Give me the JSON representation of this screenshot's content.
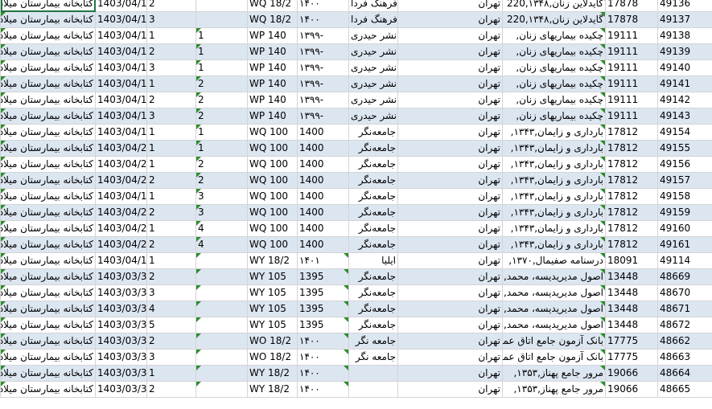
{
  "columns": [
    "library",
    "date",
    "copy",
    "volume",
    "call_number",
    "year",
    "publisher",
    "city",
    "title",
    "code",
    "record_id"
  ],
  "rows": [
    {
      "library": "کتابخانه بیمارستان میلاد",
      "date": "1403/04/1",
      "copy": "2",
      "volume": "",
      "call_number": "WQ 18/2",
      "year": "۱۴۰۰",
      "publisher": "فرهنگ فردا",
      "city": "تهران",
      "title": "گایدلاین زنان,220,۱۳۴۸",
      "code": "17878",
      "record_id": "49136"
    },
    {
      "library": "کتابخانه بیمارستان میلاد",
      "date": "1403/04/1",
      "copy": "3",
      "volume": "",
      "call_number": "WQ 18/2",
      "year": "۱۴۰۰",
      "publisher": "فرهنگ فردا",
      "city": "تهران",
      "title": "گایدلاین زنان,220,۱۳۴۸",
      "code": "17878",
      "record_id": "49137"
    },
    {
      "library": "کتابخانه بیمارستان میلاد",
      "date": "1403/04/1",
      "copy": "1",
      "volume": "1",
      "call_number": "WP 140",
      "year": "۱۳۹۹-",
      "publisher": "نشر حیدری",
      "city": "تهران",
      "title": "چکیده بیماریهای زنان,",
      "code": "19111",
      "record_id": "49138"
    },
    {
      "library": "کتابخانه بیمارستان میلاد",
      "date": "1403/04/1",
      "copy": "2",
      "volume": "1",
      "call_number": "WP 140",
      "year": "۱۳۹۹-",
      "publisher": "نشر حیدری",
      "city": "تهران",
      "title": "چکیده بیماریهای زنان,",
      "code": "19111",
      "record_id": "49139"
    },
    {
      "library": "کتابخانه بیمارستان میلاد",
      "date": "1403/04/1",
      "copy": "3",
      "volume": "1",
      "call_number": "WP 140",
      "year": "۱۳۹۹-",
      "publisher": "نشر حیدری",
      "city": "تهران",
      "title": "چکیده بیماریهای زنان,",
      "code": "19111",
      "record_id": "49140"
    },
    {
      "library": "کتابخانه بیمارستان میلاد",
      "date": "1403/04/1",
      "copy": "1",
      "volume": "2",
      "call_number": "WP 140",
      "year": "۱۳۹۹-",
      "publisher": "نشر حیدری",
      "city": "تهران",
      "title": "چکیده بیماریهای زنان,",
      "code": "19111",
      "record_id": "49141"
    },
    {
      "library": "کتابخانه بیمارستان میلاد",
      "date": "1403/04/1",
      "copy": "2",
      "volume": "2",
      "call_number": "WP 140",
      "year": "۱۳۹۹-",
      "publisher": "نشر حیدری",
      "city": "تهران",
      "title": "چکیده بیماریهای زنان,",
      "code": "19111",
      "record_id": "49142"
    },
    {
      "library": "کتابخانه بیمارستان میلاد",
      "date": "1403/04/1",
      "copy": "3",
      "volume": "2",
      "call_number": "WP 140",
      "year": "۱۳۹۹-",
      "publisher": "نشر حیدری",
      "city": "تهران",
      "title": "چکیده بیماریهای زنان,",
      "code": "19111",
      "record_id": "49143"
    },
    {
      "library": "کتابخانه بیمارستان میلاد",
      "date": "1403/04/1",
      "copy": "1",
      "volume": "1",
      "call_number": "WQ 100",
      "year": "1400",
      "publisher": "جامعه‌نگر",
      "city": "تهران",
      "title": "بارداری و زایمان,۱۳۴۳,",
      "code": "17812",
      "record_id": "49154"
    },
    {
      "library": "کتابخانه بیمارستان میلاد",
      "date": "1403/04/2",
      "copy": "1",
      "volume": "1",
      "call_number": "WQ 100",
      "year": "1400",
      "publisher": "جامعه‌نگر",
      "city": "تهران",
      "title": "بارداری و زایمان,۱۳۴۳,",
      "code": "17812",
      "record_id": "49155"
    },
    {
      "library": "کتابخانه بیمارستان میلاد",
      "date": "1403/04/2",
      "copy": "1",
      "volume": "2",
      "call_number": "WQ 100",
      "year": "1400",
      "publisher": "جامعه‌نگر",
      "city": "تهران",
      "title": "بارداری و زایمان,۱۳۴۳,",
      "code": "17812",
      "record_id": "49156"
    },
    {
      "library": "کتابخانه بیمارستان میلاد",
      "date": "1403/04/2",
      "copy": "2",
      "volume": "2",
      "call_number": "WQ 100",
      "year": "1400",
      "publisher": "جامعه‌نگر",
      "city": "تهران",
      "title": "بارداری و زایمان,۱۳۴۳,",
      "code": "17812",
      "record_id": "49157"
    },
    {
      "library": "کتابخانه بیمارستان میلاد",
      "date": "1403/04/1",
      "copy": "1",
      "volume": "3",
      "call_number": "WQ 100",
      "year": "1400",
      "publisher": "جامعه‌نگر",
      "city": "تهران",
      "title": "بارداری و زایمان,۱۳۴۳,",
      "code": "17812",
      "record_id": "49158"
    },
    {
      "library": "کتابخانه بیمارستان میلاد",
      "date": "1403/04/2",
      "copy": "2",
      "volume": "3",
      "call_number": "WQ 100",
      "year": "1400",
      "publisher": "جامعه‌نگر",
      "city": "تهران",
      "title": "بارداری و زایمان,۱۳۴۳,",
      "code": "17812",
      "record_id": "49159"
    },
    {
      "library": "کتابخانه بیمارستان میلاد",
      "date": "1403/04/2",
      "copy": "1",
      "volume": "4",
      "call_number": "WQ 100",
      "year": "1400",
      "publisher": "جامعه‌نگر",
      "city": "تهران",
      "title": "بارداری و زایمان,۱۳۴۳,",
      "code": "17812",
      "record_id": "49160"
    },
    {
      "library": "کتابخانه بیمارستان میلاد",
      "date": "1403/04/2",
      "copy": "2",
      "volume": "4",
      "call_number": "WQ 100",
      "year": "1400",
      "publisher": "جامعه‌نگر",
      "city": "تهران",
      "title": "بارداری و زایمان,۱۳۴۳,",
      "code": "17812",
      "record_id": "49161"
    },
    {
      "library": "کتابخانه بیمارستان میلاد",
      "date": "1403/04/1",
      "copy": "1",
      "volume": "",
      "call_number": "WY 18/2",
      "year": "۱۴۰۱",
      "publisher": "ایلیا",
      "city": "تهران",
      "title": "درسنامه صفیمال,۱۳۷۰,",
      "code": "18091",
      "record_id": "49114"
    },
    {
      "library": "کتابخانه بیمارستان میلاد",
      "date": "1403/03/3",
      "copy": "2",
      "volume": "",
      "call_number": "WY 105",
      "year": "1395",
      "publisher": "جامعه‌نگر",
      "city": "تهران",
      "title": "اصول مدیریدیسه، محمد,",
      "code": "13448",
      "record_id": "48669"
    },
    {
      "library": "کتابخانه بیمارستان میلاد",
      "date": "1403/03/3",
      "copy": "3",
      "volume": "",
      "call_number": "WY 105",
      "year": "1395",
      "publisher": "جامعه‌نگر",
      "city": "تهران",
      "title": "اصول مدیریدیسه، محمد,",
      "code": "13448",
      "record_id": "48670"
    },
    {
      "library": "کتابخانه بیمارستان میلاد",
      "date": "1403/03/3",
      "copy": "4",
      "volume": "",
      "call_number": "WY 105",
      "year": "1395",
      "publisher": "جامعه‌نگر",
      "city": "تهران",
      "title": "اصول مدیریدیسه، محمد,",
      "code": "13448",
      "record_id": "48671"
    },
    {
      "library": "کتابخانه بیمارستان میلاد",
      "date": "1403/03/3",
      "copy": "5",
      "volume": "",
      "call_number": "WY 105",
      "year": "1395",
      "publisher": "جامعه‌نگر",
      "city": "تهران",
      "title": "اصول مدیریدیسه، محمد,",
      "code": "13448",
      "record_id": "48672"
    },
    {
      "library": "کتابخانه بیمارستان میلاد",
      "date": "1403/03/3",
      "copy": "2",
      "volume": "",
      "call_number": "WO 18/2",
      "year": "۱۴۰۰",
      "publisher": "جامعه نگر",
      "city": "تهران",
      "title": "بانک آزمون جامع اتاق عمل ..",
      "code": "17775",
      "record_id": "48662"
    },
    {
      "library": "کتابخانه بیمارستان میلاد",
      "date": "1403/03/3",
      "copy": "3",
      "volume": "",
      "call_number": "WO 18/2",
      "year": "۱۴۰۰",
      "publisher": "جامعه نگر",
      "city": "تهران",
      "title": "بانک آزمون جامع اتاق عمل ..",
      "code": "17775",
      "record_id": "48663"
    },
    {
      "library": "کتابخانه بیمارستان میلاد",
      "date": "1403/03/3",
      "copy": "1",
      "volume": "",
      "call_number": "WY 18/2",
      "year": "۱۴۰۰",
      "publisher": "",
      "city": "تهران",
      "title": "مرور جامع پهناز,۱۳۵۳,",
      "code": "19066",
      "record_id": "48664"
    },
    {
      "library": "کتابخانه بیمارستان میلاد",
      "date": "1403/03/3",
      "copy": "2",
      "volume": "",
      "call_number": "WY 18/2",
      "year": "۱۴۰۰",
      "publisher": "",
      "city": "تهران",
      "title": "مرور جامع پهناز,۱۳۵۳,",
      "code": "19066",
      "record_id": "48665"
    }
  ]
}
